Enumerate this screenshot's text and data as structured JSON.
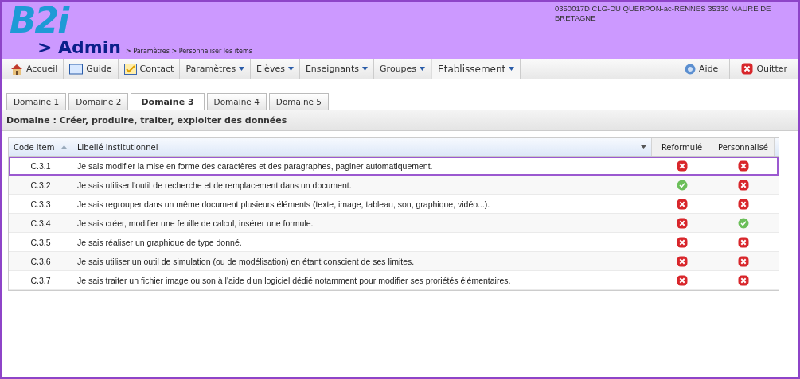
{
  "header": {
    "logo": "B2i",
    "section": "> Admin",
    "breadcrumb": "> Paramètres > Personnaliser les items",
    "school": "0350017D CLG-DU QUERPON-ac-RENNES 35330 MAURE DE BRETAGNE"
  },
  "nav": [
    {
      "label": "Accueil",
      "kind": "home",
      "selected": false
    },
    {
      "label": "Guide",
      "kind": "book",
      "selected": false
    },
    {
      "label": "Contact",
      "kind": "note",
      "selected": false
    },
    {
      "label": "Paramètres",
      "kind": "menu",
      "selected": false
    },
    {
      "label": "Elèves",
      "kind": "menu",
      "selected": false
    },
    {
      "label": "Enseignants",
      "kind": "menu",
      "selected": false
    },
    {
      "label": "Groupes",
      "kind": "menu",
      "selected": false
    },
    {
      "label": "Etablissement",
      "kind": "menu",
      "selected": true
    }
  ],
  "nav_right": [
    {
      "label": "Aide",
      "kind": "help"
    },
    {
      "label": "Quitter",
      "kind": "quit"
    }
  ],
  "tabs": [
    {
      "label": "Domaine 1",
      "selected": false
    },
    {
      "label": "Domaine 2",
      "selected": false
    },
    {
      "label": "Domaine 3",
      "selected": true
    },
    {
      "label": "Domaine 4",
      "selected": false
    },
    {
      "label": "Domaine 5",
      "selected": false
    }
  ],
  "domain_title": "Domaine : Créer, produire, traiter, exploiter des données",
  "table": {
    "columns": [
      "Code item",
      "Libellé institutionnel",
      "Reformulé",
      "Personnalisé"
    ],
    "rows": [
      {
        "code": "C.3.1",
        "label": "Je sais modifier la mise en forme des caractères et des paragraphes, paginer automatiquement.",
        "reformule": false,
        "personnalise": false,
        "selected": true
      },
      {
        "code": "C.3.2",
        "label": "Je sais utiliser l'outil de recherche et de remplacement dans un document.",
        "reformule": true,
        "personnalise": false,
        "selected": false
      },
      {
        "code": "C.3.3",
        "label": "Je sais regrouper dans un même document plusieurs éléments (texte, image, tableau, son, graphique, vidéo...).",
        "reformule": false,
        "personnalise": false,
        "selected": false
      },
      {
        "code": "C.3.4",
        "label": "Je sais créer, modifier une feuille de calcul, insérer une formule.",
        "reformule": false,
        "personnalise": true,
        "selected": false
      },
      {
        "code": "C.3.5",
        "label": "Je sais réaliser un graphique de type donné.",
        "reformule": false,
        "personnalise": false,
        "selected": false
      },
      {
        "code": "C.3.6",
        "label": "Je sais utiliser un outil de simulation (ou de modélisation) en étant conscient de ses limites.",
        "reformule": false,
        "personnalise": false,
        "selected": false
      },
      {
        "code": "C.3.7",
        "label": "Je sais traiter un fichier image ou son à l'aide d'un logiciel dédié notamment pour modifier ses proriétés élémentaires.",
        "reformule": false,
        "personnalise": false,
        "selected": false
      }
    ]
  }
}
